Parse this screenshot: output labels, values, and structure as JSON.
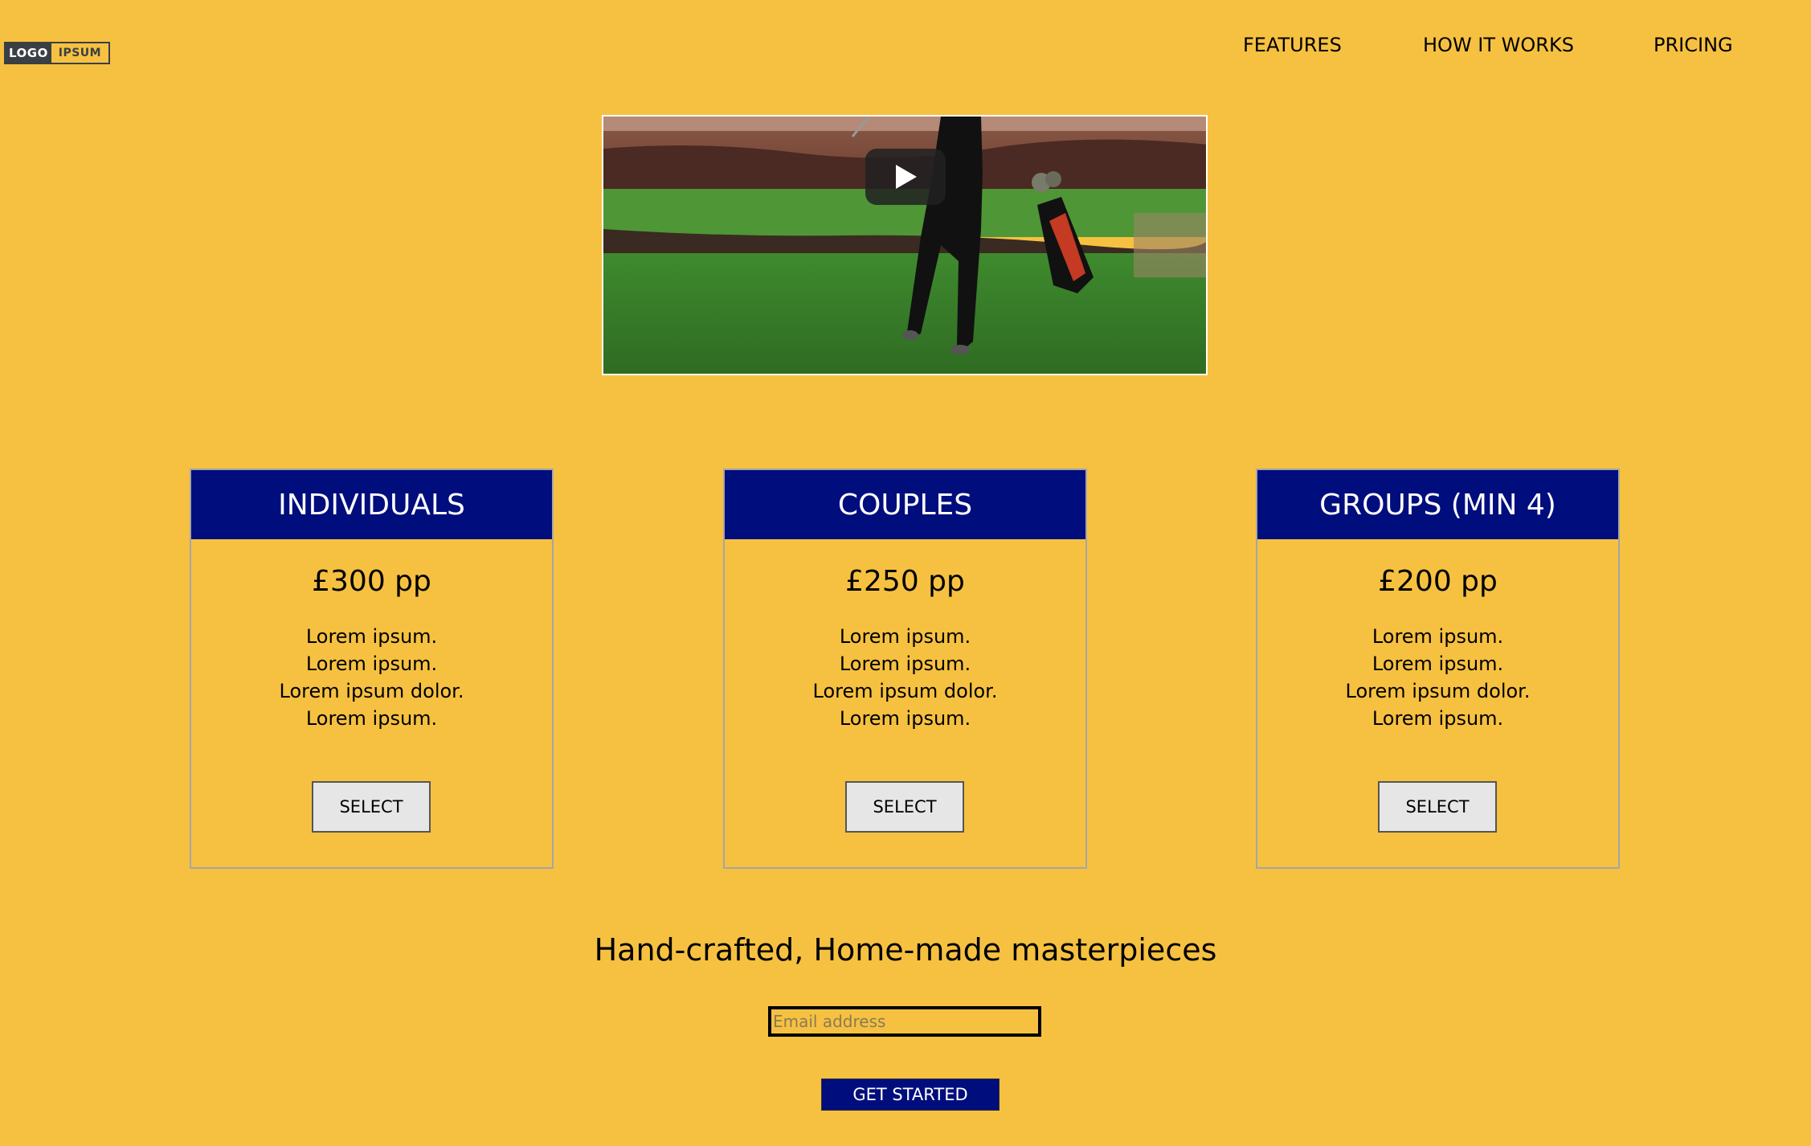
{
  "logo": {
    "part1": "LOGO",
    "part2": "IPSUM"
  },
  "nav": [
    {
      "label": "FEATURES"
    },
    {
      "label": "HOW IT WORKS"
    },
    {
      "label": "PRICING"
    }
  ],
  "video": {
    "icon": "play-icon"
  },
  "pricing": [
    {
      "title": "INDIVIDUALS",
      "price": "£300 pp",
      "features": [
        "Lorem ipsum.",
        "Lorem ipsum.",
        "Lorem ipsum dolor.",
        "Lorem ipsum."
      ],
      "button": "SELECT"
    },
    {
      "title": "COUPLES",
      "price": "£250 pp",
      "features": [
        "Lorem ipsum.",
        "Lorem ipsum.",
        "Lorem ipsum dolor.",
        "Lorem ipsum."
      ],
      "button": "SELECT"
    },
    {
      "title": "GROUPS (MIN 4)",
      "price": "£200 pp",
      "features": [
        "Lorem ipsum.",
        "Lorem ipsum.",
        "Lorem ipsum dolor.",
        "Lorem ipsum."
      ],
      "button": "SELECT"
    }
  ],
  "signup": {
    "tagline": "Hand-crafted, Home-made masterpieces",
    "email_placeholder": "Email address",
    "email_value": "",
    "cta": "GET STARTED"
  },
  "colors": {
    "background": "#f6c141",
    "accent": "#000d7d",
    "button_bg": "#e6e6e6"
  }
}
